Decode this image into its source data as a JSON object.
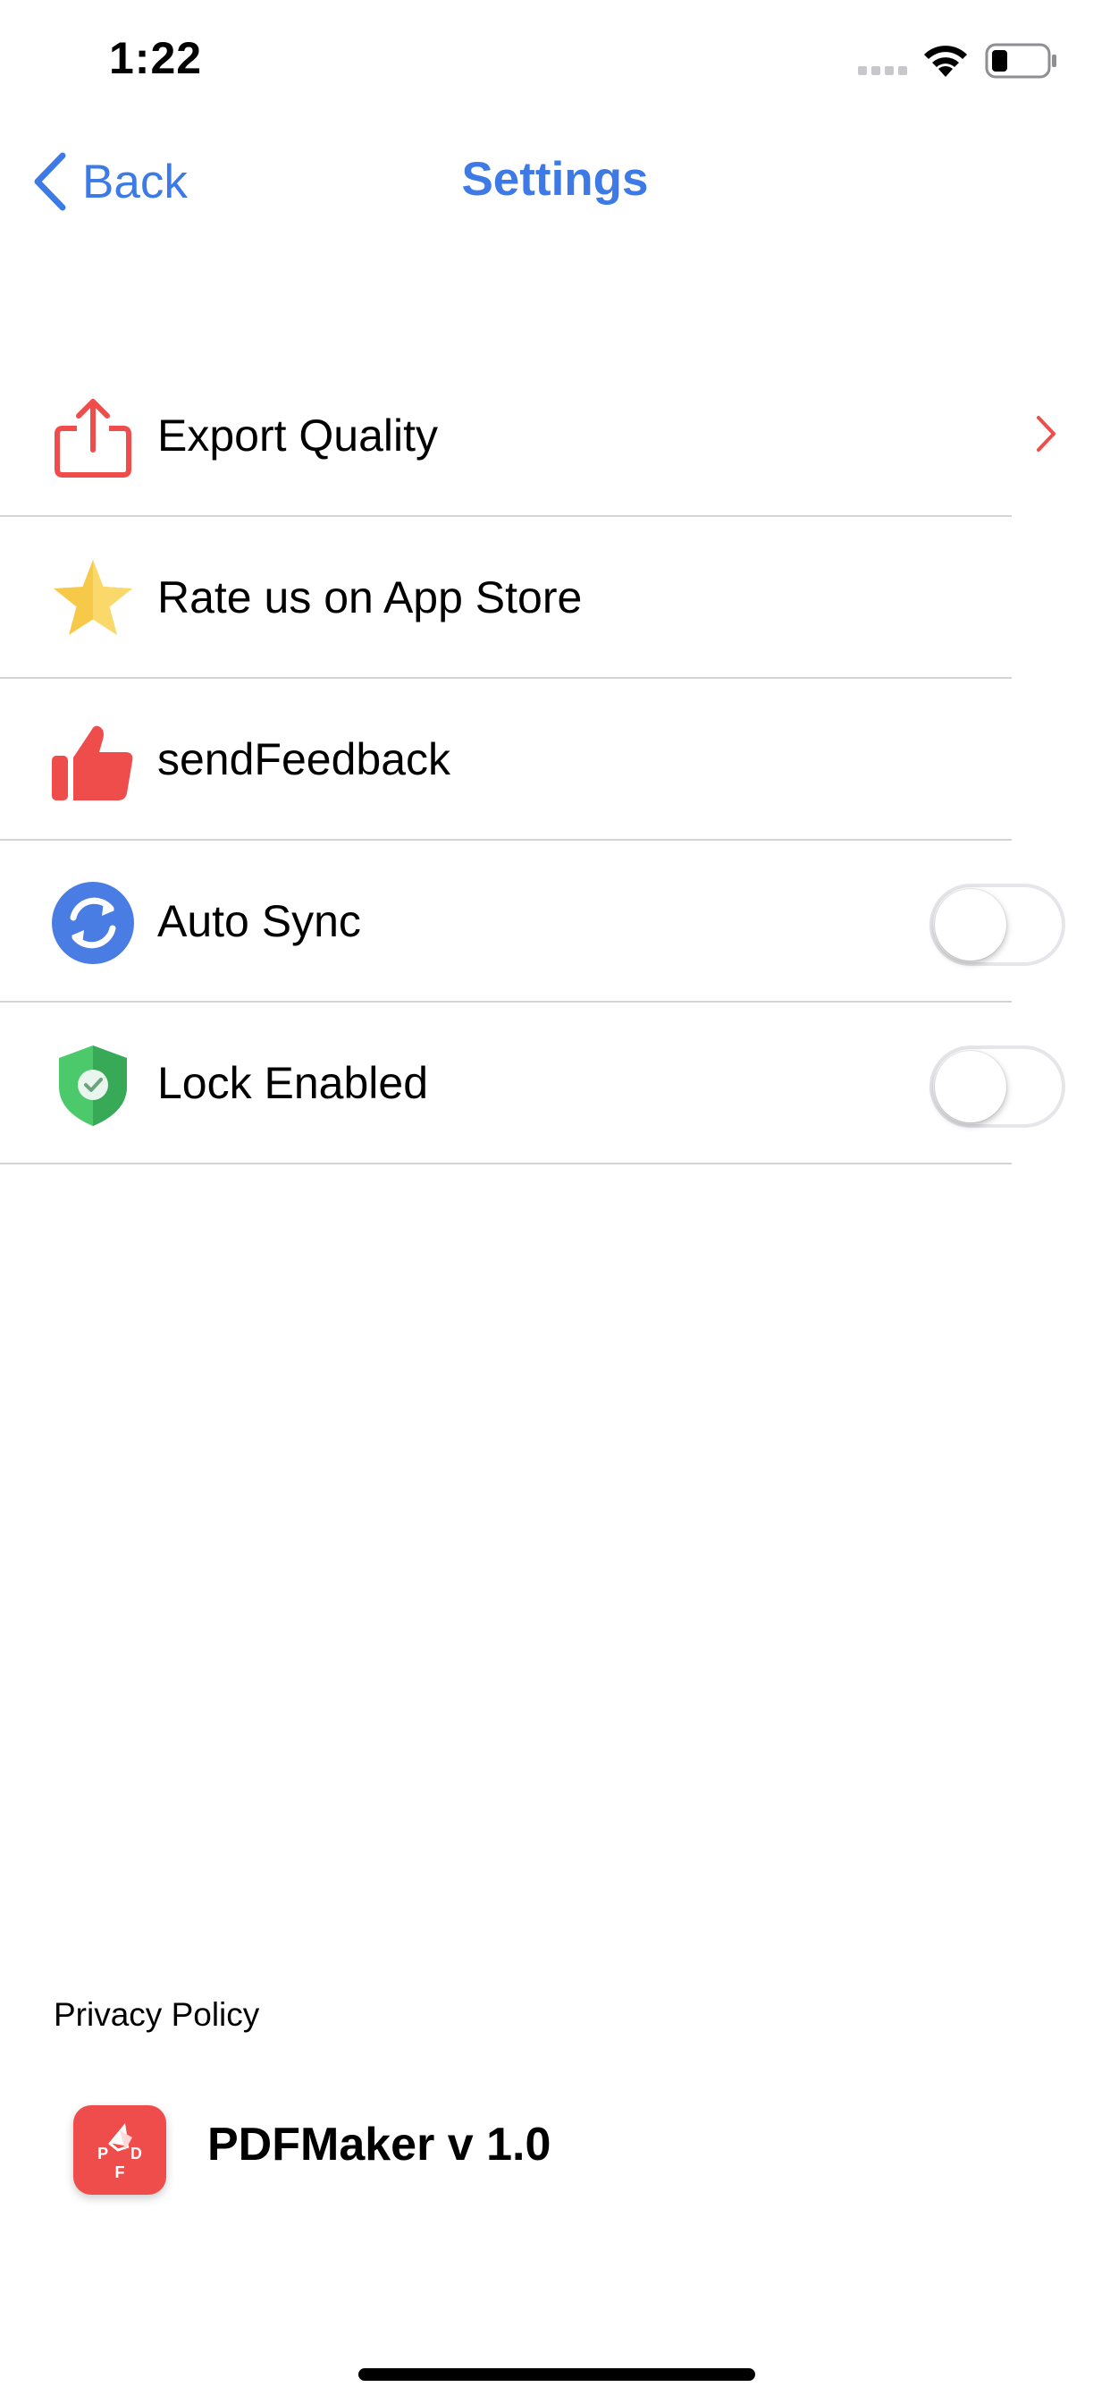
{
  "status_bar": {
    "time": "1:22"
  },
  "nav": {
    "back_label": "Back",
    "title": "Settings"
  },
  "settings": {
    "items": [
      {
        "label": "Export Quality",
        "icon": "share-icon"
      },
      {
        "label": "Rate us on App Store",
        "icon": "star-icon"
      },
      {
        "label": "sendFeedback",
        "icon": "thumbs-up-icon"
      },
      {
        "label": "Auto Sync",
        "icon": "sync-icon",
        "toggle": "off"
      },
      {
        "label": "Lock Enabled",
        "icon": "shield-icon",
        "toggle": "off"
      }
    ]
  },
  "footer": {
    "privacy_label": "Privacy Policy",
    "app_logo_text": "P D F",
    "version": "PDFMaker v 1.0"
  },
  "colors": {
    "accent": "#3e7ae6",
    "brand_red": "#ef4d4b",
    "separator": "#d4d4d4"
  }
}
